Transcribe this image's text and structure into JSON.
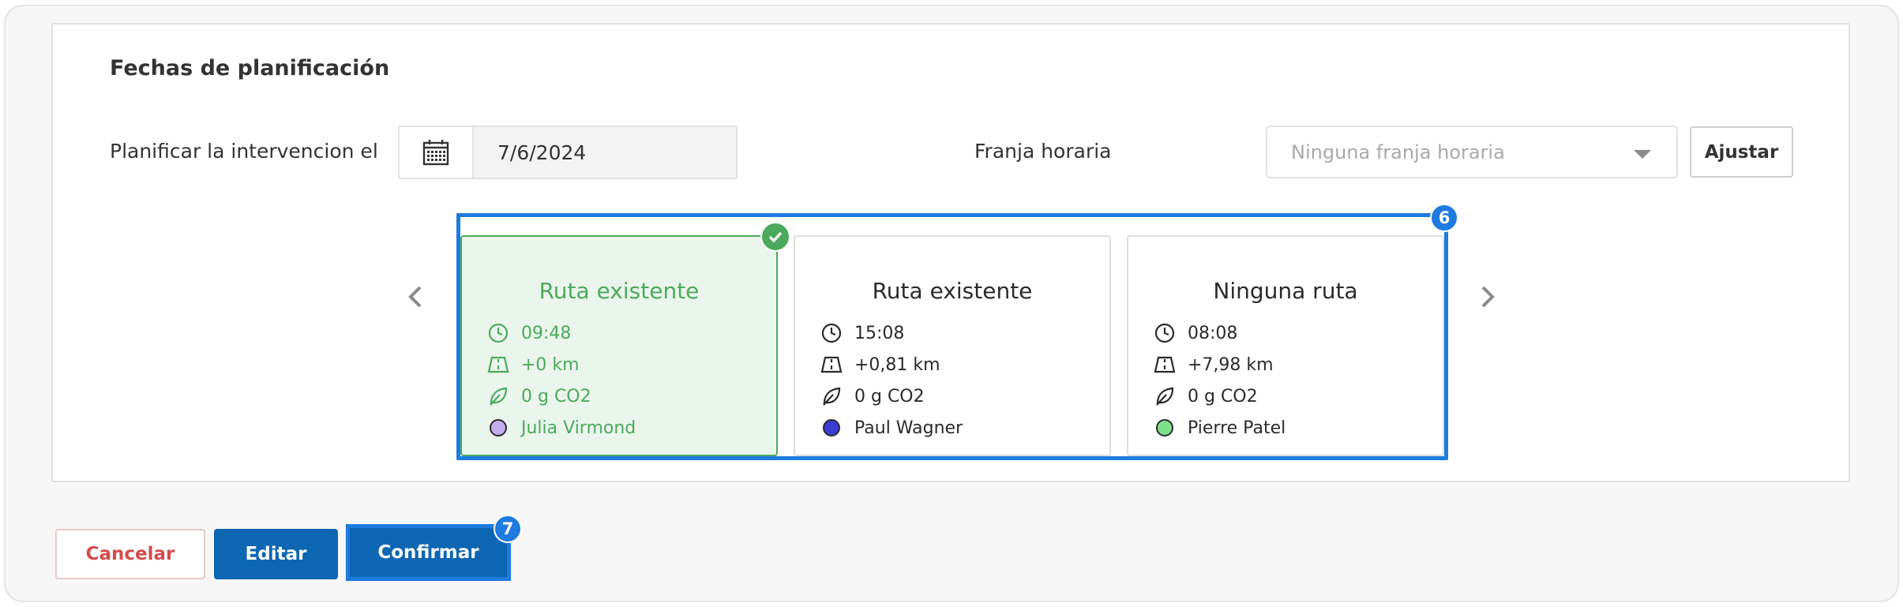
{
  "section": {
    "title": "Fechas de planificación"
  },
  "plan": {
    "label": "Planificar la intervencion el",
    "date_value": "7/6/2024",
    "calendar_icon": "calendar-icon"
  },
  "slot": {
    "label": "Franja horaria",
    "placeholder": "Ninguna franja horaria",
    "adjust_label": "Ajustar"
  },
  "cards_group_badge": "6",
  "routes": [
    {
      "title": "Ruta existente",
      "time": "09:48",
      "distance": "+0 km",
      "co2": "0 g CO2",
      "driver": "Julia Virmond",
      "driver_color": "#c5aef0",
      "selected": true
    },
    {
      "title": "Ruta existente",
      "time": "15:08",
      "distance": "+0,81 km",
      "co2": "0 g CO2",
      "driver": "Paul Wagner",
      "driver_color": "#3b3bd6",
      "selected": false
    },
    {
      "title": "Ninguna ruta",
      "time": "08:08",
      "distance": "+7,98 km",
      "co2": "0 g CO2",
      "driver": "Pierre Patel",
      "driver_color": "#7ee08a",
      "selected": false
    }
  ],
  "actions": {
    "cancel_label": "Cancelar",
    "edit_label": "Editar",
    "confirm_label": "Confirmar",
    "confirm_badge": "7"
  },
  "colors": {
    "accent_blue": "#1e7be0",
    "primary_button": "#0d66b2",
    "selected_green": "#4caa5c",
    "cancel_red": "#d64b4b"
  }
}
